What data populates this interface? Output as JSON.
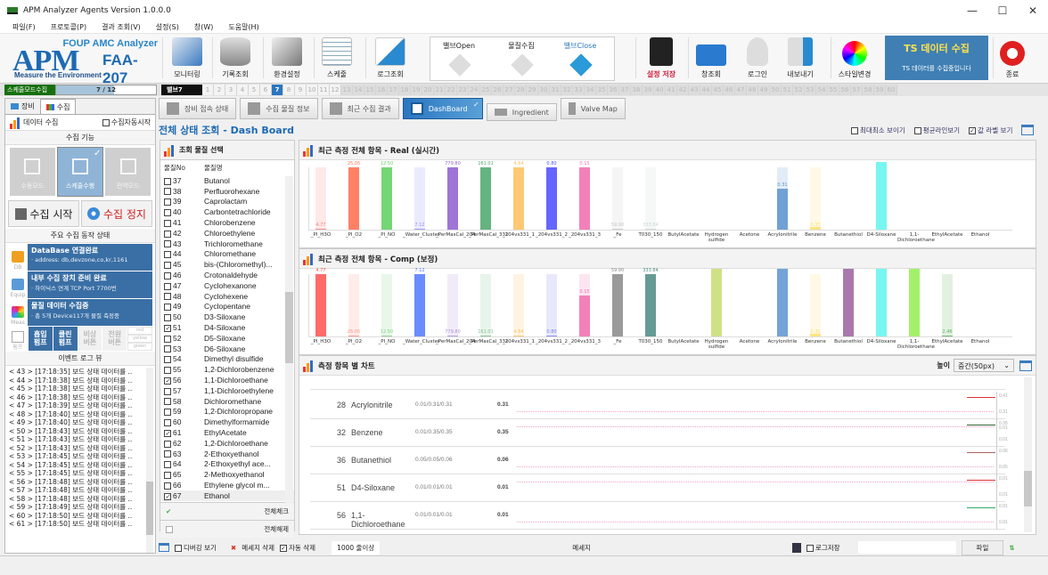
{
  "window": {
    "title": "APM Analyzer Agents Version 1.0.0.0",
    "min": "—",
    "max": "☐",
    "close": "✕"
  },
  "menu": [
    "파일(F)",
    "프로토콜(P)",
    "결과 조회(V)",
    "설정(S)",
    "창(W)",
    "도움말(H)"
  ],
  "logo": {
    "subtitle": "FOUP AMC Analyzer",
    "brand": "APM",
    "model": "FAA-207",
    "tagline": "Measure the Environment"
  },
  "ribbon": {
    "monitoring": "모니터링",
    "history": "기록조회",
    "env": "환경설정",
    "schedule": "스케줄",
    "log": "로그조회",
    "valve_open": "밸브Open",
    "collect": "물질수집",
    "valve_close": "밸브Close",
    "save": "설정 저장",
    "window": "창조회",
    "login": "로그인",
    "export": "내보내기",
    "style": "스타일변경",
    "ts_title": "TS 데이터 수집",
    "ts_sub": "TS 데이터를 수집중입니다",
    "exit": "종료"
  },
  "progress": {
    "mode": "스케줄모드수집",
    "label": "7 / 12",
    "fraction": 0.58,
    "valve_label": "밸브7",
    "current_valve": 7,
    "valves_total": 60,
    "enabled_until": 12
  },
  "left": {
    "tabs": [
      "장비",
      "수집"
    ],
    "data_collect": "데이터 수집",
    "auto_start": "수집자동시작",
    "func_title": "수집 기능",
    "modes": [
      "수동모드",
      "스케줄수행",
      "전역모드"
    ],
    "start": "수집 시작",
    "stop": "수집 정지",
    "status_title": "주요 수집 동작 상태",
    "status": [
      {
        "tag": "DB",
        "title": "DataBase 연결완료",
        "sub": "· address: db,devzone,co,kr,1161"
      },
      {
        "tag": "Equip",
        "title": "내부 수집 장치 준비 완료",
        "sub": "· 하이닉스 연계 TCP Port 7700번"
      },
      {
        "tag": "Meas",
        "title": "물질 데이터 수집중",
        "sub": "· 총 5개 Device117개 물질 측정중"
      }
    ],
    "pump_tag": "펌프",
    "pumps": [
      "흡입\n펌프",
      "클린\n펌프",
      "비상\n버튼",
      "전원\n버튼"
    ],
    "lights": [
      "red",
      "yellow",
      "green"
    ],
    "log_title": "이벤트 로그 뷰",
    "logs": [
      "< 43 > [17:18:35] 보드 상태 데이터를 ..",
      "< 44 > [17:18:38] 보드 상태 데이터를 ..",
      "< 45 > [17:18:38] 보드 상태 데이터를 ..",
      "< 46 > [17:18:38] 보드 상태 데이터를 ..",
      "< 47 > [17:18:39] 보드 상태 데이터를 ..",
      "< 48 > [17:18:40] 보드 상태 데이터를 ..",
      "< 49 > [17:18:40] 보드 상태 데이터를 ..",
      "< 50 > [17:18:43] 보드 상태 데이터를 ..",
      "< 51 > [17:18:43] 보드 상태 데이터를 ..",
      "< 52 > [17:18:43] 보드 상태 데이터를 ..",
      "< 53 > [17:18:45] 보드 상태 데이터를 ..",
      "< 54 > [17:18:45] 보드 상태 데이터를 ..",
      "< 55 > [17:18:45] 보드 상태 데이터를 ..",
      "< 56 > [17:18:48] 보드 상태 데이터를 ..",
      "< 57 > [17:18:48] 보드 상태 데이터를 ..",
      "< 58 > [17:18:48] 보드 상태 데이터를 ..",
      "< 59 > [17:18:49] 보드 상태 데이터를 ..",
      "< 60 > [17:18:50] 보드 상태 데이터를 ..",
      "< 61 > [17:18:50] 보드 상태 데이터를 .."
    ]
  },
  "tabs": [
    "장비 접속 상태",
    "수집 물질 정보",
    "최근 수집 결과",
    "DashBoard",
    "Ingredient",
    "Valve Map"
  ],
  "center_title": "전체 상태 조회 - Dash Board",
  "options": {
    "minmax": "최대최소 보이기",
    "avg": "평균라인보기",
    "value_label": "값 라벨 보기"
  },
  "materials": {
    "title": "조회 물질 선택",
    "col_no": "물질No",
    "col_name": "물질명",
    "rows": [
      {
        "no": "37",
        "name": "Butanol",
        "checked": false
      },
      {
        "no": "38",
        "name": "Perfluorohexane",
        "checked": false
      },
      {
        "no": "39",
        "name": "Caprolactam",
        "checked": false
      },
      {
        "no": "40",
        "name": "Carbontetrachloride",
        "checked": false
      },
      {
        "no": "41",
        "name": "Chlorobenzene",
        "checked": false
      },
      {
        "no": "42",
        "name": "Chloroethylene",
        "checked": false
      },
      {
        "no": "43",
        "name": "Trichloromethane",
        "checked": false
      },
      {
        "no": "44",
        "name": "Chloromethane",
        "checked": false
      },
      {
        "no": "45",
        "name": "bis-(Chloromethyl)...",
        "checked": false
      },
      {
        "no": "46",
        "name": "Crotonaldehyde",
        "checked": false
      },
      {
        "no": "47",
        "name": "Cyclohexanone",
        "checked": false
      },
      {
        "no": "48",
        "name": "Cyclohexene",
        "checked": false
      },
      {
        "no": "49",
        "name": "Cyclopentane",
        "checked": false
      },
      {
        "no": "50",
        "name": "D3-Siloxane",
        "checked": false
      },
      {
        "no": "51",
        "name": "D4-Siloxane",
        "checked": true
      },
      {
        "no": "52",
        "name": "D5-Siloxane",
        "checked": false
      },
      {
        "no": "53",
        "name": "D6-Siloxane",
        "checked": false
      },
      {
        "no": "54",
        "name": "Dimethyl disulfide",
        "checked": false
      },
      {
        "no": "55",
        "name": "1,2-Dichlorobenzene",
        "checked": false
      },
      {
        "no": "56",
        "name": "1,1-Dichloroethane",
        "checked": true
      },
      {
        "no": "57",
        "name": "1,1-Dichloroethylene",
        "checked": false
      },
      {
        "no": "58",
        "name": "Dichloromethane",
        "checked": false
      },
      {
        "no": "59",
        "name": "1,2-Dichloropropane",
        "checked": false
      },
      {
        "no": "60",
        "name": "Dimethylformamide",
        "checked": false
      },
      {
        "no": "61",
        "name": "EthylAcetate",
        "checked": true
      },
      {
        "no": "62",
        "name": "1,2-Dichloroethane",
        "checked": false
      },
      {
        "no": "63",
        "name": "2-Ethoxyethanol",
        "checked": false
      },
      {
        "no": "64",
        "name": "2-Ethoxyethyl ace...",
        "checked": false
      },
      {
        "no": "65",
        "name": "2-Methoxyethanol",
        "checked": false
      },
      {
        "no": "66",
        "name": "Ethylene glycol m...",
        "checked": false
      },
      {
        "no": "67",
        "name": "Ethanol",
        "checked": true
      }
    ],
    "check_all": "전체체크",
    "uncheck_all": "전체해제"
  },
  "chart_data": [
    {
      "type": "bar",
      "title": "최근 측정 전체 항목 - Real (실시간)",
      "categories": [
        "_PI_H3O",
        "_PI_O2",
        "_PI_NO",
        "_Water_Cluster",
        "_PerMasCal_204",
        "_PerMasCal_331",
        "_204vs331_1",
        "_204vs331_2",
        "_204vs331_3",
        "_Fe",
        "T030_150",
        "ButylAcetate",
        "Hydrogen sulfide",
        "Acetone",
        "Acrylonitrile",
        "Benzene",
        "Butanethiol",
        "D4-Siloxane",
        "1,1-Dichloroethane",
        "EthylAcetate",
        "Ethanol"
      ],
      "values": [
        0.02,
        1.0,
        1.0,
        0.02,
        1.0,
        1.0,
        1.0,
        1.0,
        1.0,
        0.02,
        0.02,
        0,
        0,
        0,
        0.66,
        0.05,
        0,
        1.08,
        0,
        0,
        0
      ],
      "labels": [
        "4.77",
        "25.05",
        "12.50",
        "7.12",
        "779.80",
        "161.01",
        "4.64",
        "0.80",
        "0.15",
        "59.90",
        "333.84",
        "",
        "",
        "",
        "0.31",
        "0.35",
        "",
        "",
        "",
        "",
        ""
      ],
      "colors": [
        "#ff8080",
        "#ff7050",
        "#60d060",
        "#9090ff",
        "#9060d0",
        "#50a870",
        "#ffc060",
        "#5050ff",
        "#f070b0",
        "#c8c8c8",
        "#c8d8d0",
        "#ccc",
        "#c8dc70",
        "#ccc",
        "#5b93d0",
        "#ffe070",
        "#9a60a0",
        "#60f4ee",
        "#90f050",
        "#a0d0a0",
        "#ccc"
      ],
      "show_bg": [
        true,
        true,
        true,
        true,
        true,
        true,
        true,
        true,
        true,
        true,
        true,
        false,
        false,
        false,
        true,
        true,
        false,
        false,
        false,
        false,
        false
      ]
    },
    {
      "type": "bar",
      "title": "최근 측정 전체 항목 - Comp (보정)",
      "categories": [
        "_PI_H3O",
        "_PI_O2",
        "_PI_NO",
        "_Water_Cluster",
        "_PerMasCal_204",
        "_PerMasCal_331",
        "_204vs331_1",
        "_204vs331_2",
        "_204vs331_3",
        "_Fe",
        "T030_150",
        "ButylAcetate",
        "Hydrogen sulfide",
        "Acetone",
        "Acrylonitrile",
        "Benzene",
        "Butanethiol",
        "D4-Siloxane",
        "1,1-Dichloroethane",
        "EthylAcetate",
        "Ethanol"
      ],
      "values": [
        1.0,
        0.02,
        0.02,
        1.0,
        0.02,
        0.02,
        0.02,
        0.02,
        0.66,
        1.0,
        1.0,
        0,
        1.08,
        0,
        1.08,
        0.05,
        1.08,
        1.08,
        1.08,
        0.02,
        0
      ],
      "labels": [
        "4.77",
        "25.05",
        "12.50",
        "7.12",
        "779.80",
        "161.01",
        "4.64",
        "0.80",
        "0.15",
        "59.90",
        "333.84",
        "",
        "",
        "",
        "",
        "0.35",
        "",
        "",
        "",
        "2.46",
        ""
      ],
      "colors": [
        "#ff5050",
        "#ff9080",
        "#80d080",
        "#5078ff",
        "#b090e0",
        "#80c090",
        "#ffc060",
        "#8080f0",
        "#f070b0",
        "#888888",
        "#4a8a80",
        "#ccc",
        "#c8dc70",
        "#ccc",
        "#5b93d0",
        "#ffe070",
        "#9a60a0",
        "#60f4ee",
        "#90f050",
        "#60b060",
        "#ccc"
      ],
      "show_bg": [
        false,
        true,
        true,
        false,
        true,
        true,
        true,
        true,
        true,
        false,
        false,
        false,
        false,
        false,
        false,
        true,
        false,
        false,
        false,
        true,
        false
      ]
    }
  ],
  "item_chart": {
    "title": "측정 항목 별 차트",
    "height_label": "높이",
    "height_value": "중간(50px)",
    "rows": [
      {
        "no": "28",
        "name": "Acrylonitrile",
        "minmax": "0.01/0.31/0.31",
        "val": "0.31",
        "ticks": [
          "0.41",
          "0.31",
          "0.01"
        ]
      },
      {
        "no": "32",
        "name": "Benzene",
        "minmax": "0.01/0.35/0.35",
        "val": "0.35",
        "ticks": [
          "0.35",
          "0.01"
        ]
      },
      {
        "no": "36",
        "name": "Butanethiol",
        "minmax": "0.05/0.05/0.06",
        "val": "0.06",
        "ticks": [
          "0.06",
          "0.05"
        ]
      },
      {
        "no": "51",
        "name": "D4-Siloxane",
        "minmax": "0.01/0.01/0.01",
        "val": "0.01",
        "ticks": [
          "0.01",
          "0.01"
        ]
      },
      {
        "no": "56",
        "name": "1,1-Dichloroethane",
        "minmax": "0.01/0.01/0.01",
        "val": "0.01",
        "ticks": [
          "0.01",
          "0.01"
        ]
      }
    ]
  },
  "bottom": {
    "debug": "디버깅 보기",
    "clear": "메세지 삭제",
    "auto_delete": "자동 삭제",
    "over": "1000 줄이상",
    "message": "메세지",
    "log_save": "로그저장",
    "file": "파일"
  }
}
